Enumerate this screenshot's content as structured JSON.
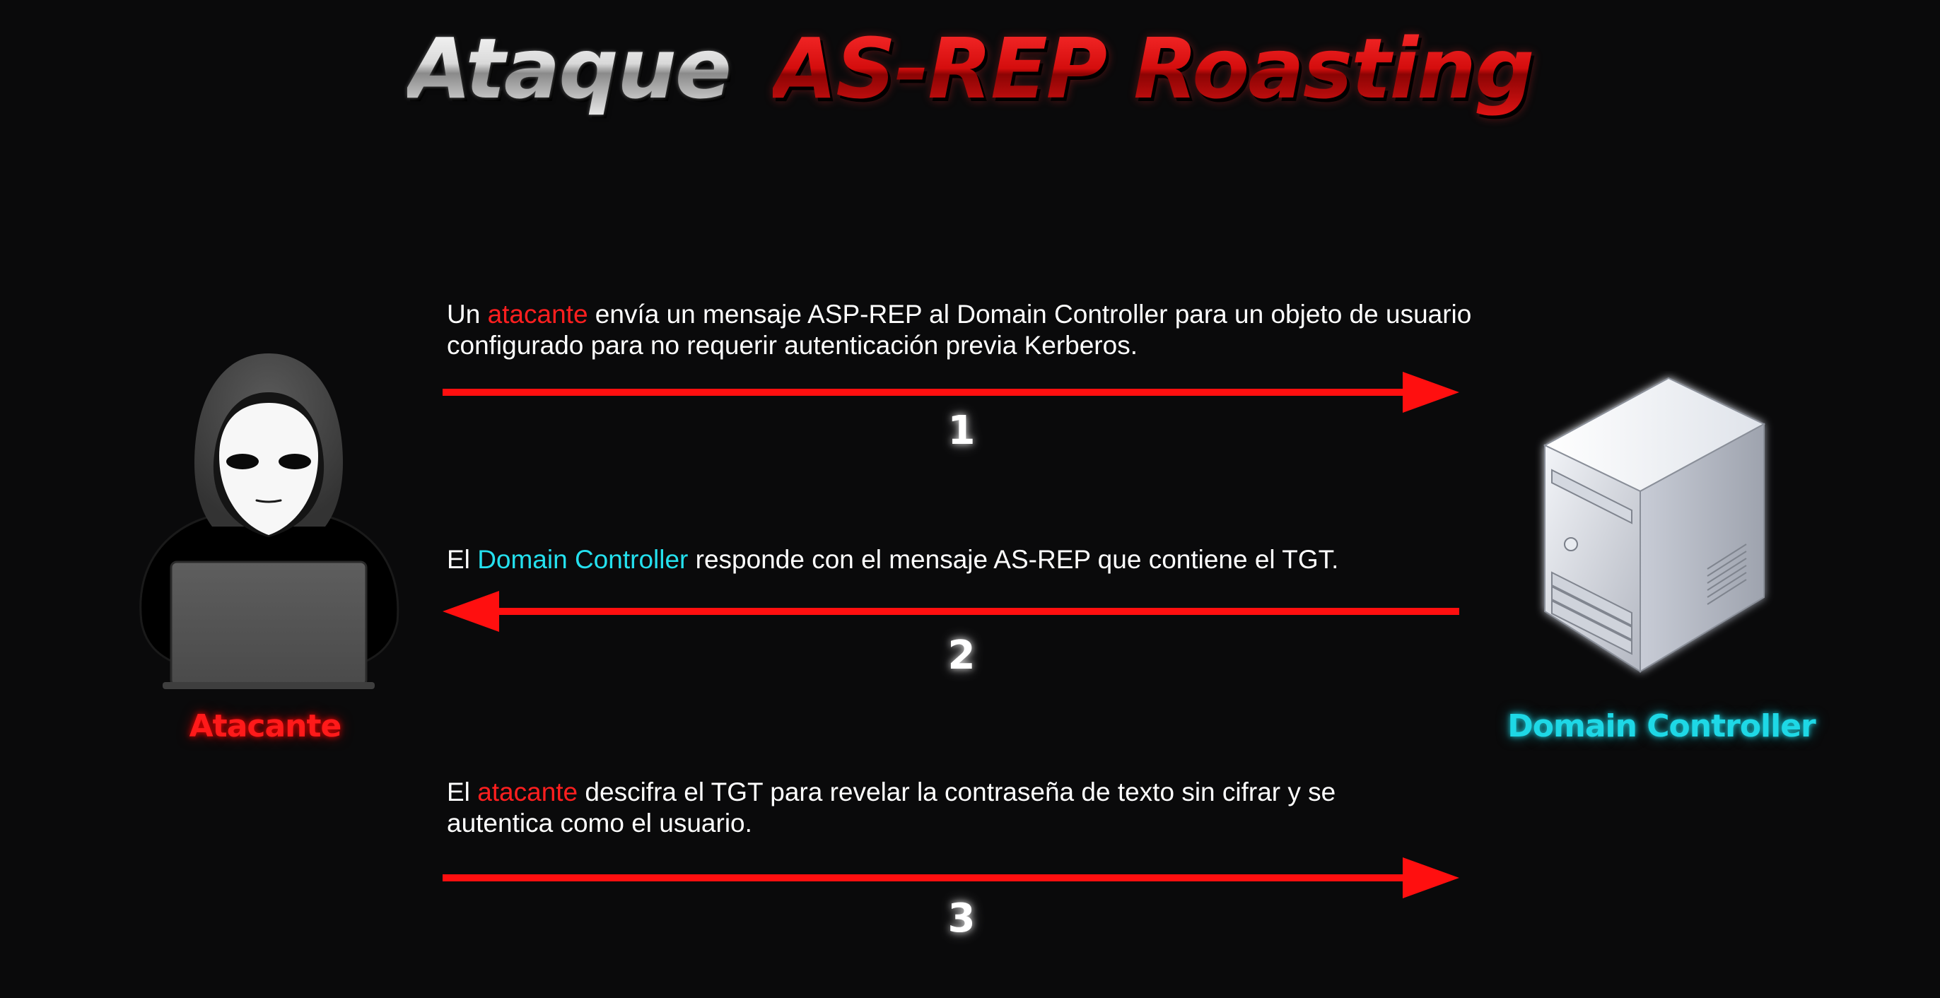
{
  "title": {
    "word1": "Ataque",
    "word2": "AS-REP Roasting"
  },
  "actors": {
    "attacker": {
      "label": "Atacante",
      "icon": "hooded-hacker-laptop-icon"
    },
    "domain_controller": {
      "label": "Domain Controller",
      "icon": "server-tower-icon"
    }
  },
  "steps": [
    {
      "number": "1",
      "direction": "attacker-to-dc",
      "line1": {
        "pre": "Un ",
        "highlight": "atacante",
        "post": " envía un mensaje ASP-REP al Domain Controller para un objeto de usuario"
      },
      "line2": "configurado para no requerir autenticación previa Kerberos."
    },
    {
      "number": "2",
      "direction": "dc-to-attacker",
      "line1": {
        "pre": "El ",
        "highlight": "Domain Controller",
        "post": " responde con el mensaje AS-REP que contiene el TGT."
      },
      "line2": ""
    },
    {
      "number": "3",
      "direction": "attacker-to-dc",
      "line1": {
        "pre": "El ",
        "highlight": "atacante",
        "post": " descifra el TGT para revelar la contraseña de texto sin cifrar y se"
      },
      "line2": "autentica como el usuario."
    }
  ],
  "colors": {
    "background": "#0a0a0b",
    "arrow": "#ff0f0f",
    "attacker_accent": "#ff1a1a",
    "dc_accent": "#1ed8e6",
    "text": "#ffffff"
  }
}
